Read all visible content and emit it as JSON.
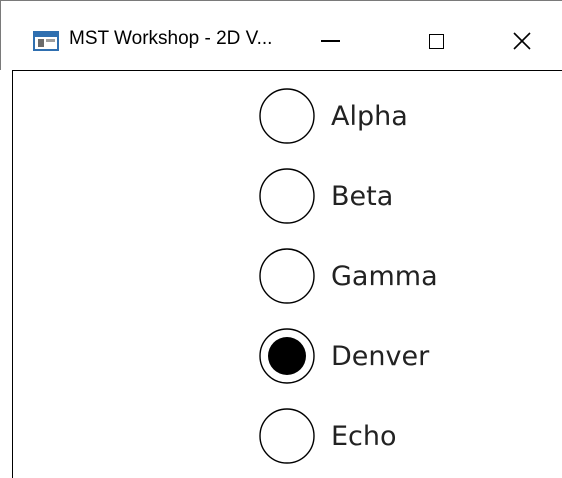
{
  "window": {
    "title": "MST Workshop - 2D V...",
    "icon": "app-window-icon",
    "controls": {
      "minimize_icon": "minimize-icon",
      "maximize_icon": "maximize-icon",
      "close_icon": "close-icon"
    }
  },
  "radio_group": {
    "options": [
      {
        "label": "Alpha",
        "selected": false
      },
      {
        "label": "Beta",
        "selected": false
      },
      {
        "label": "Gamma",
        "selected": false
      },
      {
        "label": "Denver",
        "selected": true
      },
      {
        "label": "Echo",
        "selected": false
      }
    ]
  },
  "colors": {
    "window_background": "#ffffff",
    "radio_stroke": "#000000",
    "radio_fill_selected": "#000000",
    "label_text": "#222222"
  }
}
